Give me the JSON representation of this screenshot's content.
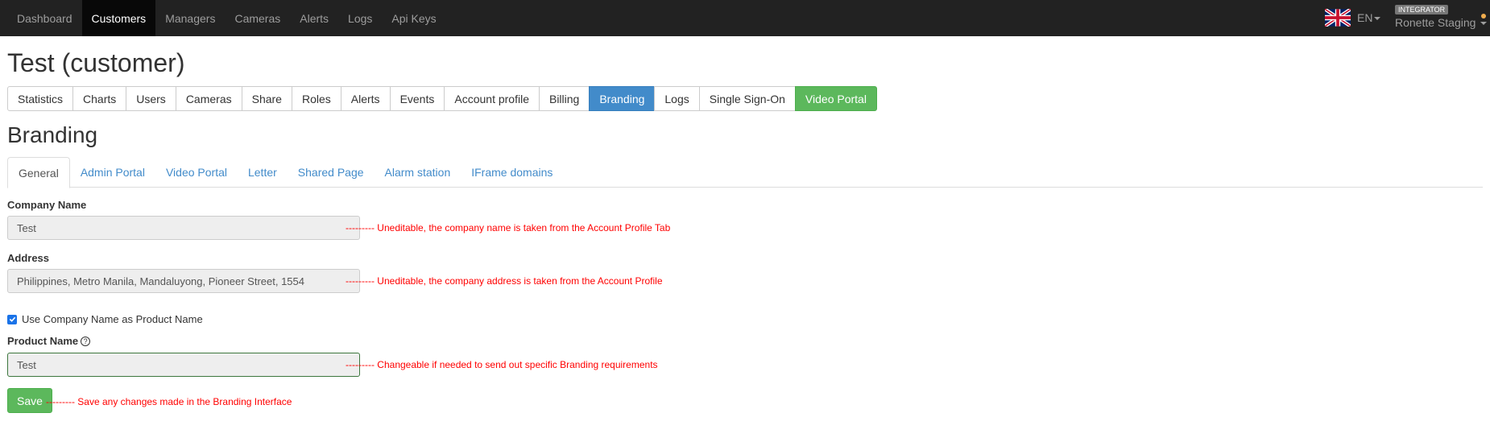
{
  "nav": {
    "items": [
      {
        "label": "Dashboard",
        "active": false
      },
      {
        "label": "Customers",
        "active": true
      },
      {
        "label": "Managers",
        "active": false
      },
      {
        "label": "Cameras",
        "active": false
      },
      {
        "label": "Alerts",
        "active": false
      },
      {
        "label": "Logs",
        "active": false
      },
      {
        "label": "Api Keys",
        "active": false
      }
    ],
    "language": "EN",
    "role_badge": "INTEGRATOR",
    "user_name": "Ronette Staging"
  },
  "page": {
    "title": "Test (customer)"
  },
  "customer_tabs": [
    {
      "label": "Statistics",
      "style": "default"
    },
    {
      "label": "Charts",
      "style": "default"
    },
    {
      "label": "Users",
      "style": "default"
    },
    {
      "label": "Cameras",
      "style": "default"
    },
    {
      "label": "Share",
      "style": "default"
    },
    {
      "label": "Roles",
      "style": "default"
    },
    {
      "label": "Alerts",
      "style": "default"
    },
    {
      "label": "Events",
      "style": "default"
    },
    {
      "label": "Account profile",
      "style": "default"
    },
    {
      "label": "Billing",
      "style": "default"
    },
    {
      "label": "Branding",
      "style": "primary"
    },
    {
      "label": "Logs",
      "style": "default"
    },
    {
      "label": "Single Sign-On",
      "style": "default"
    },
    {
      "label": "Video Portal",
      "style": "success"
    }
  ],
  "section": {
    "title": "Branding"
  },
  "branding_tabs": [
    {
      "label": "General",
      "active": true
    },
    {
      "label": "Admin Portal",
      "active": false
    },
    {
      "label": "Video Portal",
      "active": false
    },
    {
      "label": "Letter",
      "active": false
    },
    {
      "label": "Shared Page",
      "active": false
    },
    {
      "label": "Alarm station",
      "active": false
    },
    {
      "label": "IFrame domains",
      "active": false
    }
  ],
  "form": {
    "company_name": {
      "label": "Company Name",
      "value": "Test",
      "note": "--------- Uneditable, the company name is taken from the Account Profile Tab"
    },
    "address": {
      "label": "Address",
      "value": "Philippines, Metro Manila, Mandaluyong, Pioneer Street, 1554",
      "note": "--------- Uneditable, the company address is taken from the Account Profile"
    },
    "use_company_name": {
      "label": "Use Company Name as Product Name",
      "checked": true
    },
    "product_name": {
      "label": "Product Name",
      "help": "?",
      "value": "Test",
      "note": "--------- Changeable if needed to send out specific Branding requirements"
    },
    "save": {
      "label": "Save",
      "note": "--------- Save any changes made in the Branding Interface"
    }
  },
  "colors": {
    "navbar": "#222222",
    "primary": "#428bca",
    "success": "#5cb85c",
    "annotation": "#ff0000"
  }
}
